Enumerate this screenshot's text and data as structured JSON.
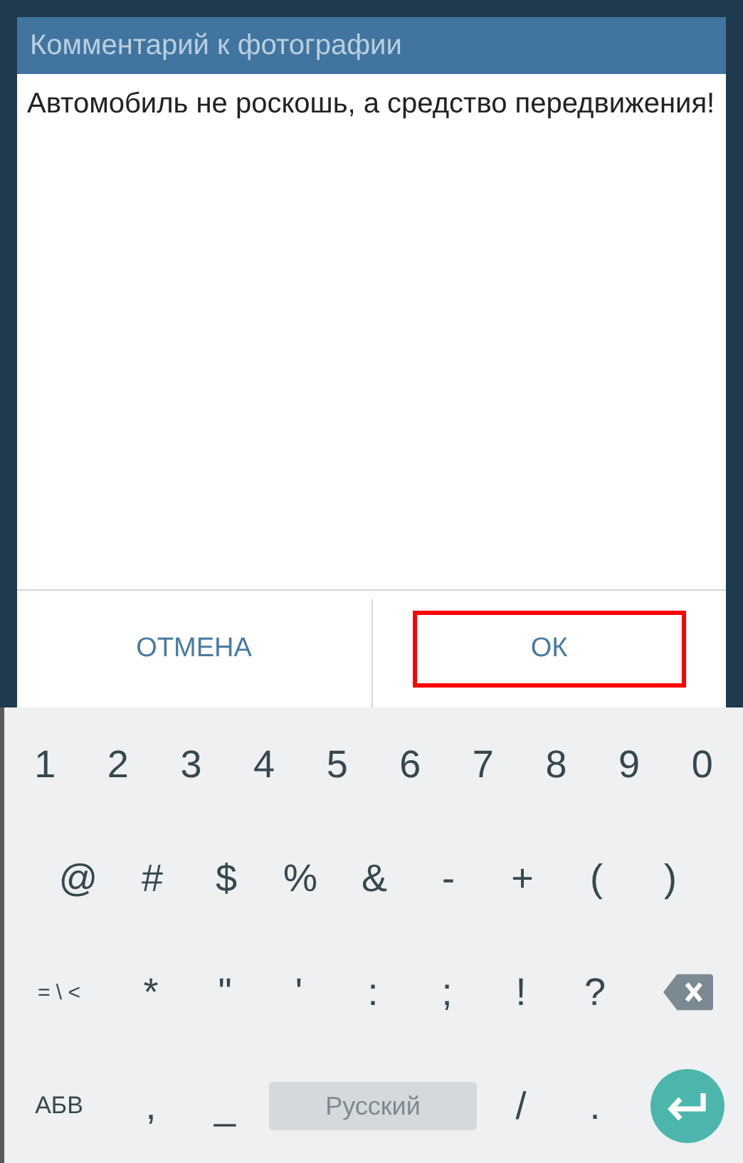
{
  "dialog": {
    "title": "Комментарий к фотографии",
    "comment": "Автомобиль не роскошь, а средство передвижения!",
    "buttons": [
      {
        "label": "ОТМЕНА",
        "highlighted": false
      },
      {
        "label": "ОК",
        "highlighted": true
      }
    ]
  },
  "keyboard": {
    "key_rows": [
      {
        "keys": [
          {
            "kind": "char",
            "label": "1"
          },
          {
            "kind": "char",
            "label": "2"
          },
          {
            "kind": "char",
            "label": "3"
          },
          {
            "kind": "char",
            "label": "4"
          },
          {
            "kind": "char",
            "label": "5"
          },
          {
            "kind": "char",
            "label": "6"
          },
          {
            "kind": "char",
            "label": "7"
          },
          {
            "kind": "char",
            "label": "8"
          },
          {
            "kind": "char",
            "label": "9"
          },
          {
            "kind": "char",
            "label": "0"
          }
        ]
      },
      {
        "keys": [
          {
            "kind": "char",
            "label": "@"
          },
          {
            "kind": "char",
            "label": "#"
          },
          {
            "kind": "char",
            "label": "$"
          },
          {
            "kind": "char",
            "label": "%"
          },
          {
            "kind": "char",
            "label": "&"
          },
          {
            "kind": "char",
            "label": "-"
          },
          {
            "kind": "char",
            "label": "+"
          },
          {
            "kind": "char",
            "label": "("
          },
          {
            "kind": "char",
            "label": ")"
          }
        ]
      },
      {
        "keys": [
          {
            "kind": "mode",
            "label": "= \\ <"
          },
          {
            "kind": "char",
            "label": "*"
          },
          {
            "kind": "char",
            "label": "\""
          },
          {
            "kind": "char",
            "label": "'"
          },
          {
            "kind": "char",
            "label": ":"
          },
          {
            "kind": "char",
            "label": ";"
          },
          {
            "kind": "char",
            "label": "!"
          },
          {
            "kind": "char",
            "label": "?"
          },
          {
            "kind": "backspace"
          }
        ]
      },
      {
        "keys": [
          {
            "kind": "mode",
            "label": "АБВ"
          },
          {
            "kind": "char",
            "label": ","
          },
          {
            "kind": "char",
            "label": "_"
          },
          {
            "kind": "space",
            "label": "Русский"
          },
          {
            "kind": "char",
            "label": "/"
          },
          {
            "kind": "char",
            "label": "."
          },
          {
            "kind": "enter"
          }
        ]
      }
    ]
  }
}
